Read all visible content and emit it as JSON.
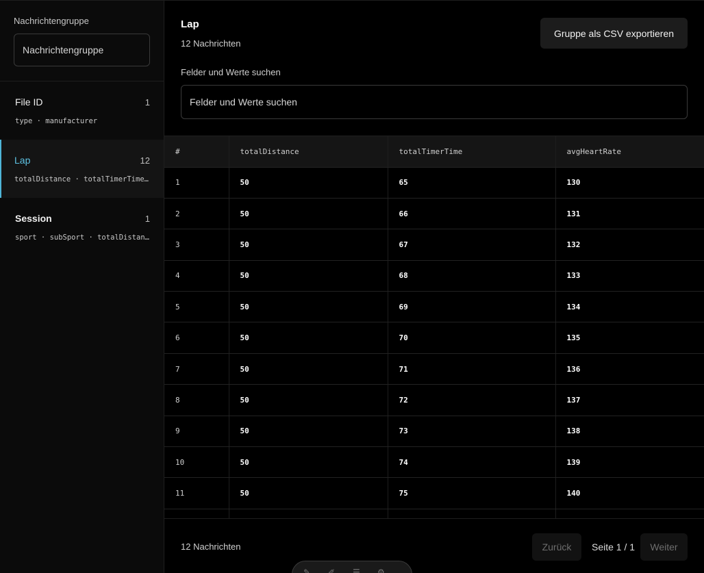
{
  "sidebar": {
    "search_label": "Nachrichtengruppe",
    "search_placeholder": "Nachrichtengruppe",
    "groups": [
      {
        "name": "File ID",
        "count": "1",
        "fields": "type · manufacturer"
      },
      {
        "name": "Lap",
        "count": "12",
        "fields": "totalDistance · totalTimerTime …"
      },
      {
        "name": "Session",
        "count": "1",
        "fields": "sport · subSport · totalDistanc…"
      }
    ]
  },
  "main": {
    "title": "Lap",
    "subtitle": "12 Nachrichten",
    "export_label": "Gruppe als CSV exportieren",
    "search_label": "Felder und Werte suchen",
    "search_placeholder": "Felder und Werte suchen"
  },
  "table": {
    "columns": [
      "#",
      "totalDistance",
      "totalTimerTime",
      "avgHeartRate"
    ],
    "rows": [
      [
        "1",
        "50",
        "65",
        "130"
      ],
      [
        "2",
        "50",
        "66",
        "131"
      ],
      [
        "3",
        "50",
        "67",
        "132"
      ],
      [
        "4",
        "50",
        "68",
        "133"
      ],
      [
        "5",
        "50",
        "69",
        "134"
      ],
      [
        "6",
        "50",
        "70",
        "135"
      ],
      [
        "7",
        "50",
        "71",
        "136"
      ],
      [
        "8",
        "50",
        "72",
        "137"
      ],
      [
        "9",
        "50",
        "73",
        "138"
      ],
      [
        "10",
        "50",
        "74",
        "139"
      ],
      [
        "11",
        "50",
        "75",
        "140"
      ],
      [
        "",
        "",
        "",
        ""
      ]
    ]
  },
  "footer": {
    "count": "12 Nachrichten",
    "prev_label": "Zurück",
    "page_info": "Seite 1 / 1",
    "next_label": "Weiter"
  },
  "dock": {
    "icons": [
      "pen-icon",
      "brush-icon",
      "menu-icon",
      "gear-icon"
    ]
  },
  "colors": {
    "accent": "#5ec3e4",
    "background": "#000000",
    "sidebar": "#0b0b0b"
  }
}
